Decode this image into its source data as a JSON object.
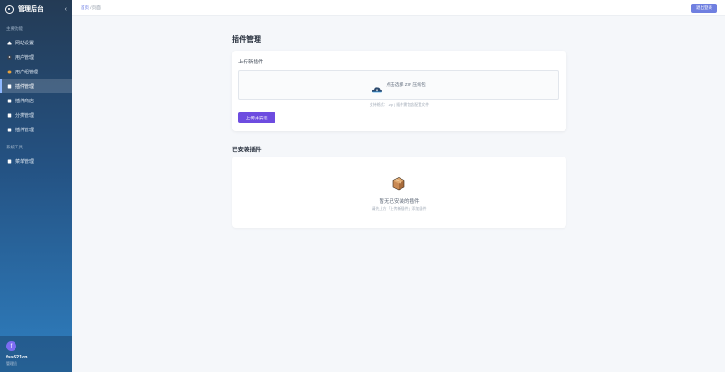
{
  "sidebar": {
    "brand_title": "管理后台",
    "collapse_icon": "chevron-left-icon",
    "section_main": "主要功能",
    "items": [
      {
        "label": "网站设置",
        "icon": "home-icon"
      },
      {
        "label": "用户管理",
        "icon": "user-icon"
      },
      {
        "label": "用户组管理",
        "icon": "users-icon"
      },
      {
        "label": "插件管理",
        "icon": "puzzle-icon",
        "active": true
      },
      {
        "label": "插件商店",
        "icon": "store-icon"
      },
      {
        "label": "分类管理",
        "icon": "folder-icon"
      },
      {
        "label": "插件管理",
        "icon": "puzzle-icon"
      }
    ],
    "section_tools": "系统工具",
    "tools": [
      {
        "label": "菜单管理",
        "icon": "menu-icon"
      }
    ],
    "user": {
      "avatar_letter": "f",
      "name": "fss521cn",
      "role": "管理员"
    }
  },
  "topbar": {
    "crumb_home": "首页",
    "crumb_sep": "/",
    "crumb_current": "页面",
    "logout_label": "退出登录"
  },
  "main": {
    "page_title": "插件管理",
    "upload_card_title": "上传新插件",
    "dropzone_text": "点击选择 ZIP 压缩包",
    "hint": "支持格式：.zip | 插件需包含配置文件",
    "upload_button": "上传并安装",
    "installed_title": "已安装插件",
    "empty_text": "暂无已安装的插件",
    "empty_sub": "请先上方「上传新插件」添加插件"
  },
  "colors": {
    "accent": "#6d4ce0",
    "logout": "#6f7fe0",
    "sidebar_top": "#243b55",
    "sidebar_bottom": "#2f7fc0"
  }
}
